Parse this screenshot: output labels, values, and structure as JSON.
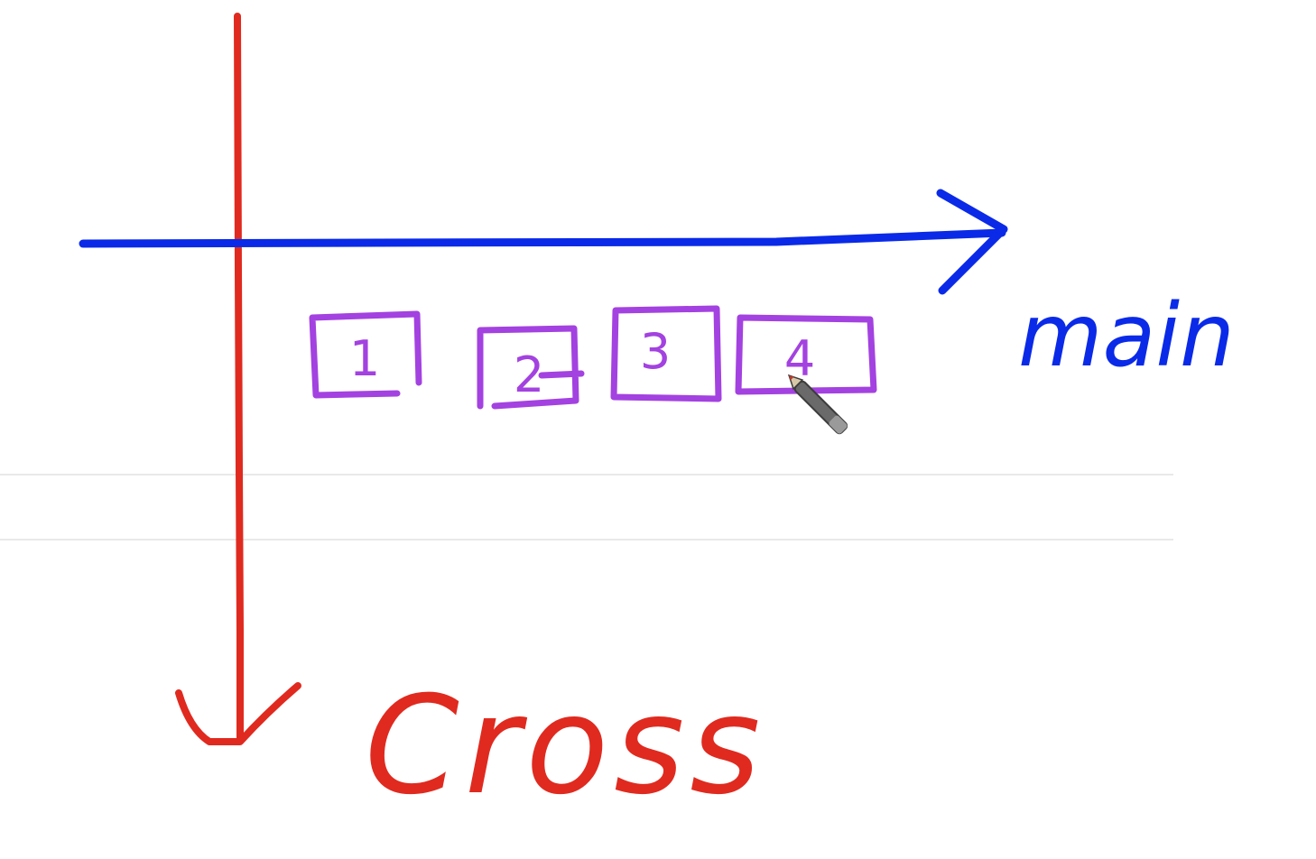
{
  "colors": {
    "cross_axis": "#e02a1f",
    "main_axis": "#0a2ae8",
    "items": "#a342e0",
    "background": "#ffffff",
    "ruled_lines": "#e9e9e9"
  },
  "axes": {
    "main_label": "main",
    "cross_label": "Cross"
  },
  "items": [
    "1",
    "2",
    "3",
    "4"
  ],
  "cursor": {
    "icon": "pen-cursor-icon"
  }
}
